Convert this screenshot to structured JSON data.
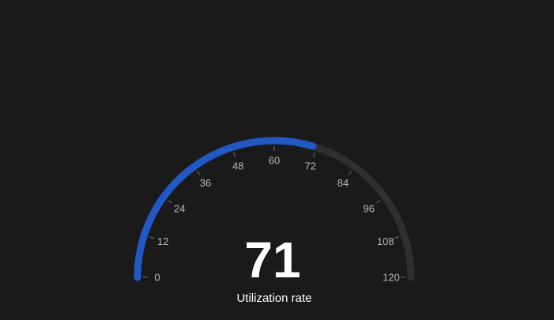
{
  "chart_data": {
    "type": "gauge",
    "title": "Utilization rate",
    "value": 71,
    "value_label": "71",
    "min": 0,
    "max": 120,
    "tick_labels": [
      "0",
      "12",
      "24",
      "36",
      "48",
      "60",
      "72",
      "84",
      "96",
      "108",
      "120"
    ],
    "colors": {
      "background": "#1a1a1a",
      "progress": "#2258c3",
      "track": "#2f2f2f",
      "tick": "#555555",
      "tick_label": "#b8b8b8",
      "value_text": "#ffffff"
    }
  }
}
